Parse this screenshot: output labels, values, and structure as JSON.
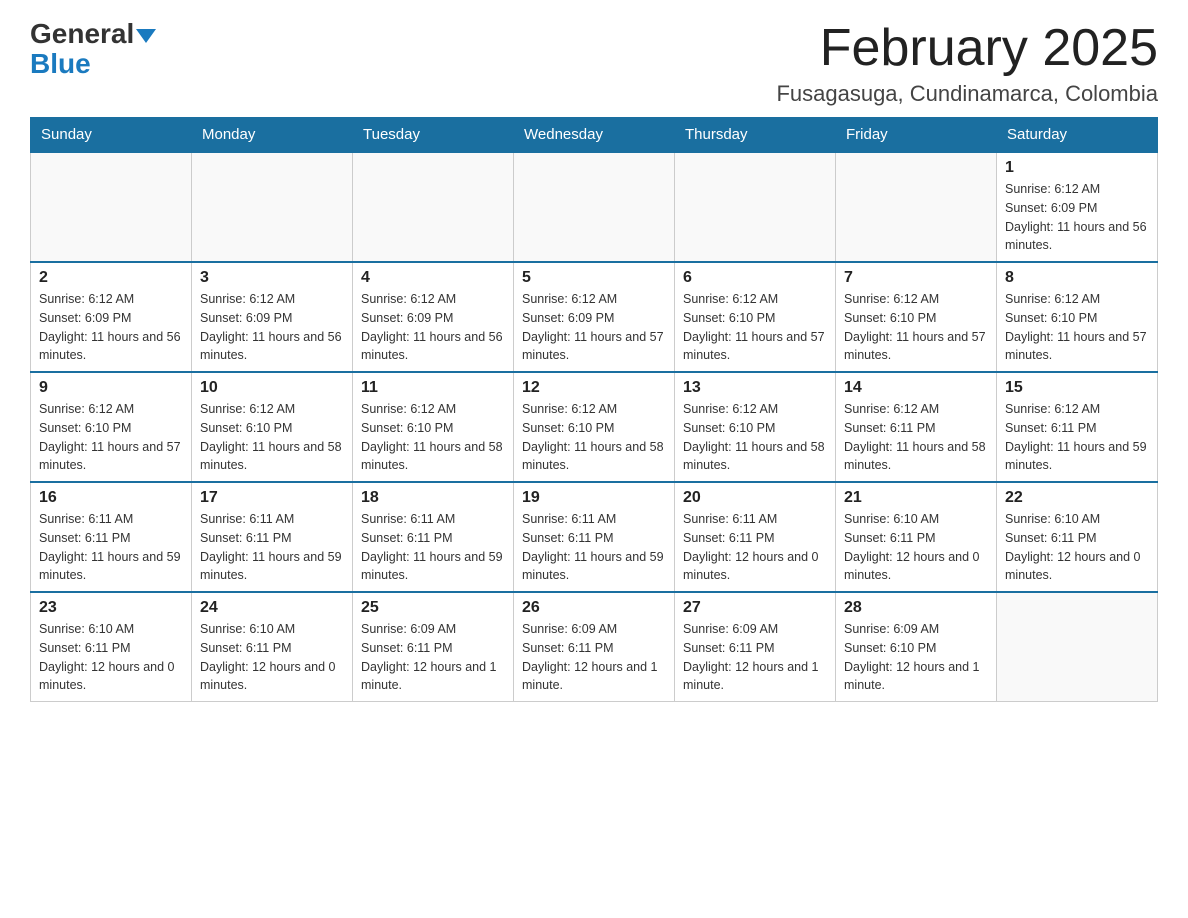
{
  "logo": {
    "part1": "General",
    "part2": "Blue"
  },
  "header": {
    "month_title": "February 2025",
    "subtitle": "Fusagasuga, Cundinamarca, Colombia"
  },
  "days_of_week": [
    "Sunday",
    "Monday",
    "Tuesday",
    "Wednesday",
    "Thursday",
    "Friday",
    "Saturday"
  ],
  "weeks": [
    {
      "days": [
        {
          "num": "",
          "info": "",
          "empty": true
        },
        {
          "num": "",
          "info": "",
          "empty": true
        },
        {
          "num": "",
          "info": "",
          "empty": true
        },
        {
          "num": "",
          "info": "",
          "empty": true
        },
        {
          "num": "",
          "info": "",
          "empty": true
        },
        {
          "num": "",
          "info": "",
          "empty": true
        },
        {
          "num": "1",
          "info": "Sunrise: 6:12 AM\nSunset: 6:09 PM\nDaylight: 11 hours and 56 minutes.",
          "empty": false
        }
      ]
    },
    {
      "days": [
        {
          "num": "2",
          "info": "Sunrise: 6:12 AM\nSunset: 6:09 PM\nDaylight: 11 hours and 56 minutes.",
          "empty": false
        },
        {
          "num": "3",
          "info": "Sunrise: 6:12 AM\nSunset: 6:09 PM\nDaylight: 11 hours and 56 minutes.",
          "empty": false
        },
        {
          "num": "4",
          "info": "Sunrise: 6:12 AM\nSunset: 6:09 PM\nDaylight: 11 hours and 56 minutes.",
          "empty": false
        },
        {
          "num": "5",
          "info": "Sunrise: 6:12 AM\nSunset: 6:09 PM\nDaylight: 11 hours and 57 minutes.",
          "empty": false
        },
        {
          "num": "6",
          "info": "Sunrise: 6:12 AM\nSunset: 6:10 PM\nDaylight: 11 hours and 57 minutes.",
          "empty": false
        },
        {
          "num": "7",
          "info": "Sunrise: 6:12 AM\nSunset: 6:10 PM\nDaylight: 11 hours and 57 minutes.",
          "empty": false
        },
        {
          "num": "8",
          "info": "Sunrise: 6:12 AM\nSunset: 6:10 PM\nDaylight: 11 hours and 57 minutes.",
          "empty": false
        }
      ]
    },
    {
      "days": [
        {
          "num": "9",
          "info": "Sunrise: 6:12 AM\nSunset: 6:10 PM\nDaylight: 11 hours and 57 minutes.",
          "empty": false
        },
        {
          "num": "10",
          "info": "Sunrise: 6:12 AM\nSunset: 6:10 PM\nDaylight: 11 hours and 58 minutes.",
          "empty": false
        },
        {
          "num": "11",
          "info": "Sunrise: 6:12 AM\nSunset: 6:10 PM\nDaylight: 11 hours and 58 minutes.",
          "empty": false
        },
        {
          "num": "12",
          "info": "Sunrise: 6:12 AM\nSunset: 6:10 PM\nDaylight: 11 hours and 58 minutes.",
          "empty": false
        },
        {
          "num": "13",
          "info": "Sunrise: 6:12 AM\nSunset: 6:10 PM\nDaylight: 11 hours and 58 minutes.",
          "empty": false
        },
        {
          "num": "14",
          "info": "Sunrise: 6:12 AM\nSunset: 6:11 PM\nDaylight: 11 hours and 58 minutes.",
          "empty": false
        },
        {
          "num": "15",
          "info": "Sunrise: 6:12 AM\nSunset: 6:11 PM\nDaylight: 11 hours and 59 minutes.",
          "empty": false
        }
      ]
    },
    {
      "days": [
        {
          "num": "16",
          "info": "Sunrise: 6:11 AM\nSunset: 6:11 PM\nDaylight: 11 hours and 59 minutes.",
          "empty": false
        },
        {
          "num": "17",
          "info": "Sunrise: 6:11 AM\nSunset: 6:11 PM\nDaylight: 11 hours and 59 minutes.",
          "empty": false
        },
        {
          "num": "18",
          "info": "Sunrise: 6:11 AM\nSunset: 6:11 PM\nDaylight: 11 hours and 59 minutes.",
          "empty": false
        },
        {
          "num": "19",
          "info": "Sunrise: 6:11 AM\nSunset: 6:11 PM\nDaylight: 11 hours and 59 minutes.",
          "empty": false
        },
        {
          "num": "20",
          "info": "Sunrise: 6:11 AM\nSunset: 6:11 PM\nDaylight: 12 hours and 0 minutes.",
          "empty": false
        },
        {
          "num": "21",
          "info": "Sunrise: 6:10 AM\nSunset: 6:11 PM\nDaylight: 12 hours and 0 minutes.",
          "empty": false
        },
        {
          "num": "22",
          "info": "Sunrise: 6:10 AM\nSunset: 6:11 PM\nDaylight: 12 hours and 0 minutes.",
          "empty": false
        }
      ]
    },
    {
      "days": [
        {
          "num": "23",
          "info": "Sunrise: 6:10 AM\nSunset: 6:11 PM\nDaylight: 12 hours and 0 minutes.",
          "empty": false
        },
        {
          "num": "24",
          "info": "Sunrise: 6:10 AM\nSunset: 6:11 PM\nDaylight: 12 hours and 0 minutes.",
          "empty": false
        },
        {
          "num": "25",
          "info": "Sunrise: 6:09 AM\nSunset: 6:11 PM\nDaylight: 12 hours and 1 minute.",
          "empty": false
        },
        {
          "num": "26",
          "info": "Sunrise: 6:09 AM\nSunset: 6:11 PM\nDaylight: 12 hours and 1 minute.",
          "empty": false
        },
        {
          "num": "27",
          "info": "Sunrise: 6:09 AM\nSunset: 6:11 PM\nDaylight: 12 hours and 1 minute.",
          "empty": false
        },
        {
          "num": "28",
          "info": "Sunrise: 6:09 AM\nSunset: 6:10 PM\nDaylight: 12 hours and 1 minute.",
          "empty": false
        },
        {
          "num": "",
          "info": "",
          "empty": true
        }
      ]
    }
  ]
}
